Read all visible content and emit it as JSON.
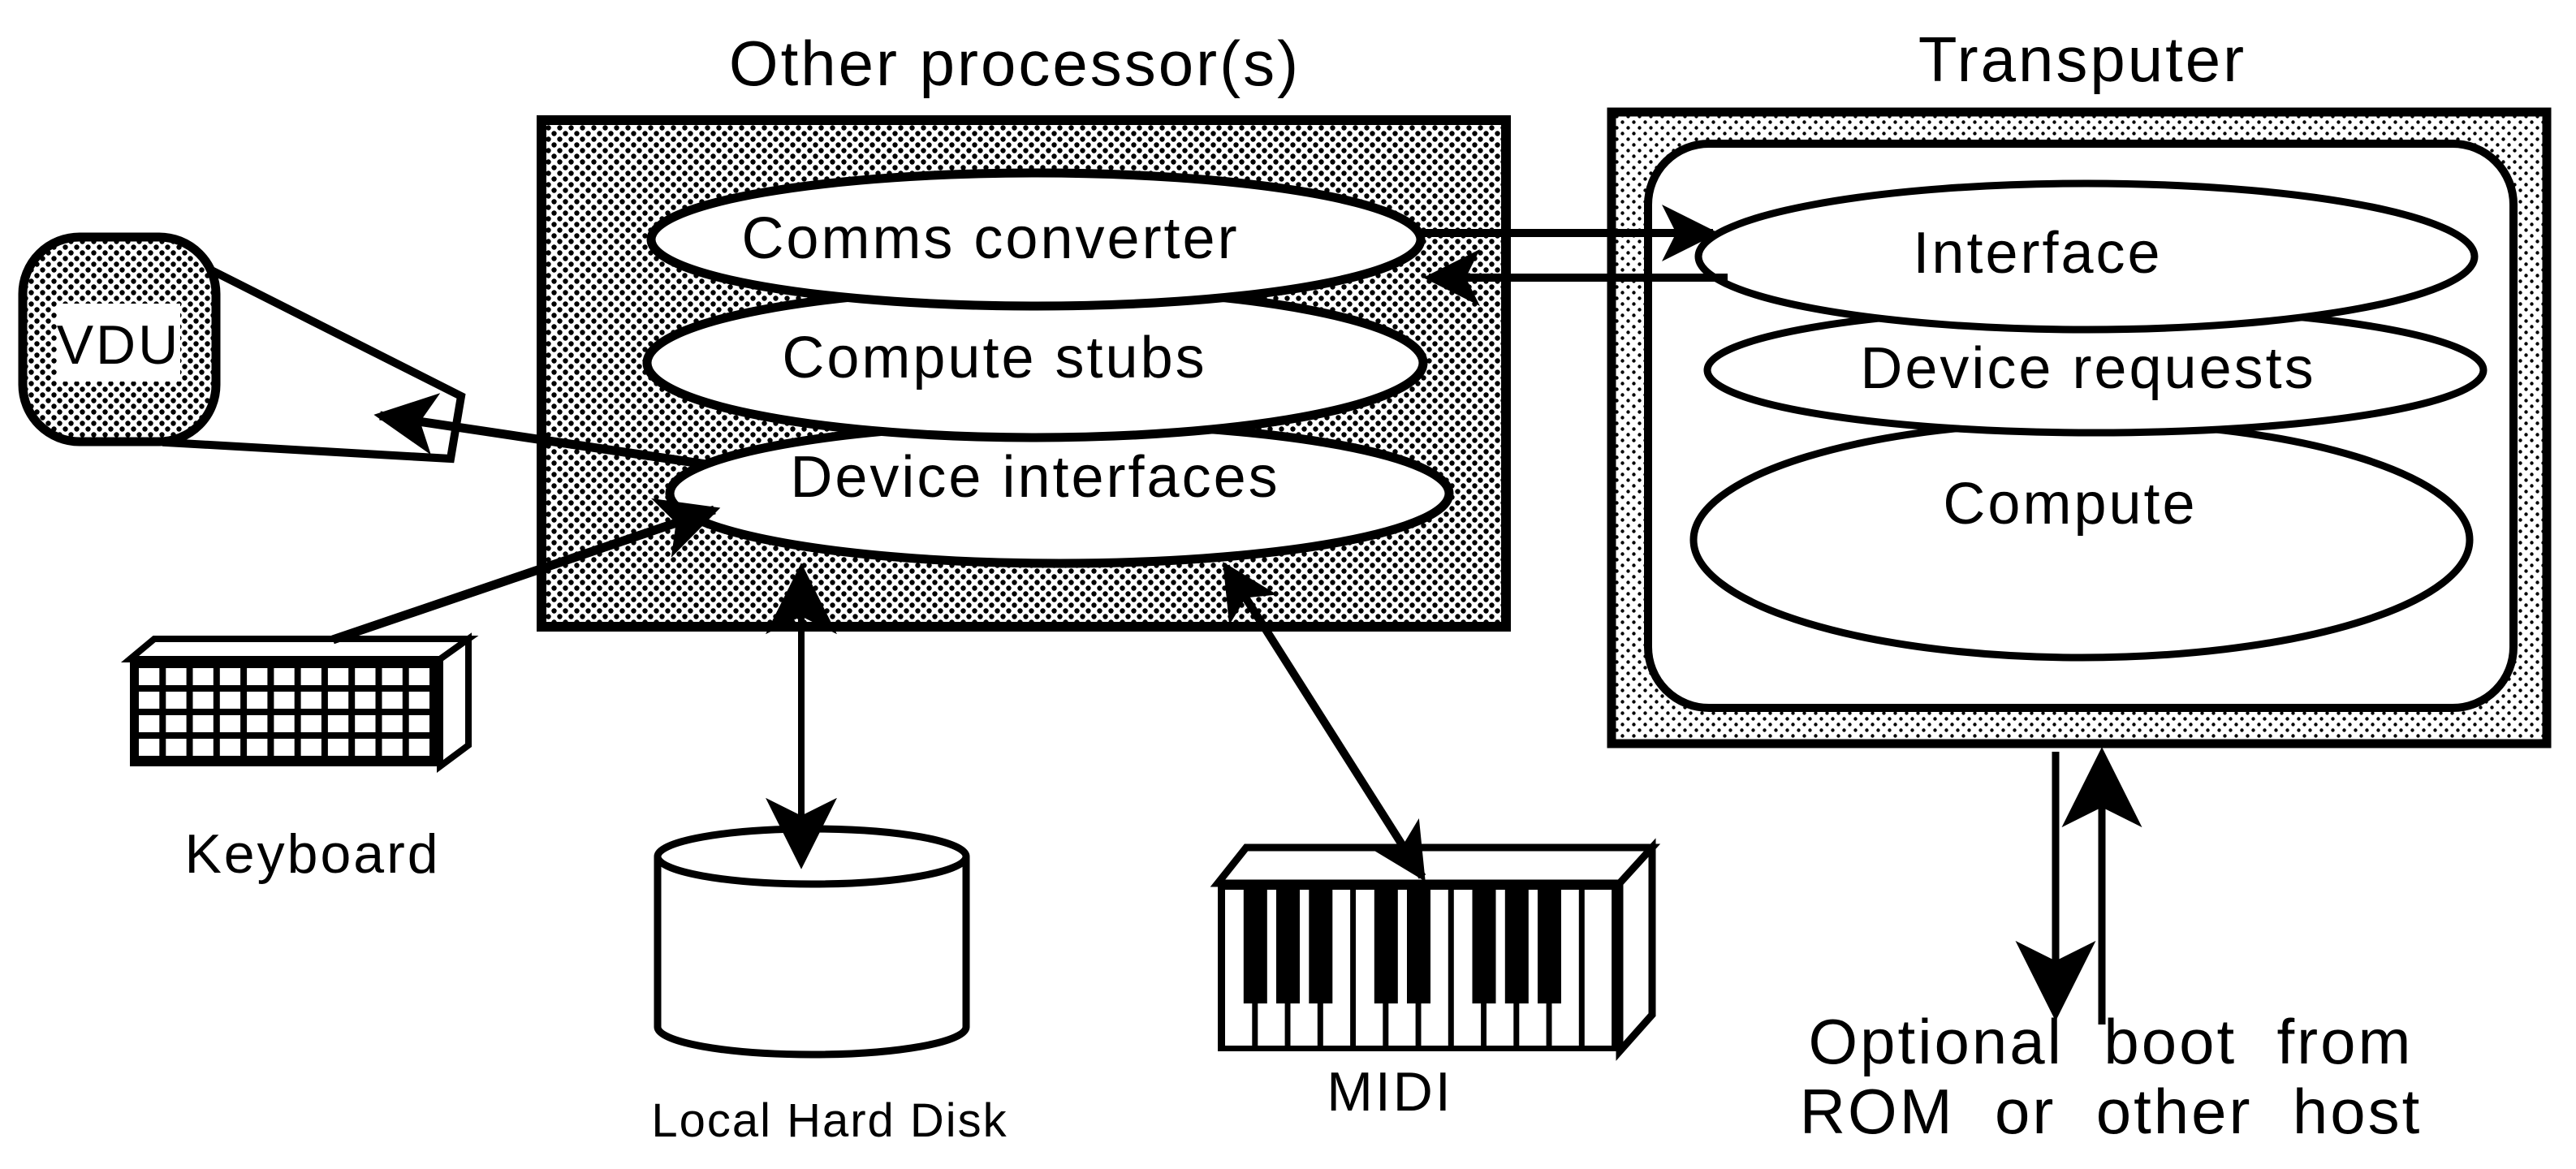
{
  "diagram": {
    "colors": {
      "ink": "#000000",
      "paper": "#ffffff"
    },
    "other_processor": {
      "title": "Other processor(s)",
      "layers": [
        {
          "label": "Comms converter"
        },
        {
          "label": "Compute stubs"
        },
        {
          "label": "Device interfaces"
        }
      ]
    },
    "transputer": {
      "title": "Transputer",
      "layers": [
        {
          "label": "Interface"
        },
        {
          "label": "Device requests"
        },
        {
          "label": "Compute"
        }
      ]
    },
    "devices": {
      "vdu": {
        "label": "VDU"
      },
      "keyboard": {
        "label": "Keyboard"
      },
      "disk": {
        "label": "Local Hard Disk"
      },
      "midi": {
        "label": "MIDI"
      }
    },
    "boot_note": {
      "line1": "Optional  boot  from",
      "line2": "ROM  or  other  host"
    },
    "connections": [
      {
        "from": "Comms converter",
        "to": "Interface",
        "direction": "to"
      },
      {
        "from": "Interface",
        "to": "Comms converter",
        "direction": "to"
      },
      {
        "from": "Device interfaces",
        "to": "VDU",
        "direction": "to"
      },
      {
        "from": "Keyboard",
        "to": "Device interfaces",
        "direction": "to"
      },
      {
        "from": "Device interfaces",
        "to": "Local Hard Disk",
        "direction": "both"
      },
      {
        "from": "Device interfaces",
        "to": "MIDI",
        "direction": "both"
      },
      {
        "from": "Transputer",
        "to": "Optional boot",
        "direction": "both"
      }
    ]
  }
}
